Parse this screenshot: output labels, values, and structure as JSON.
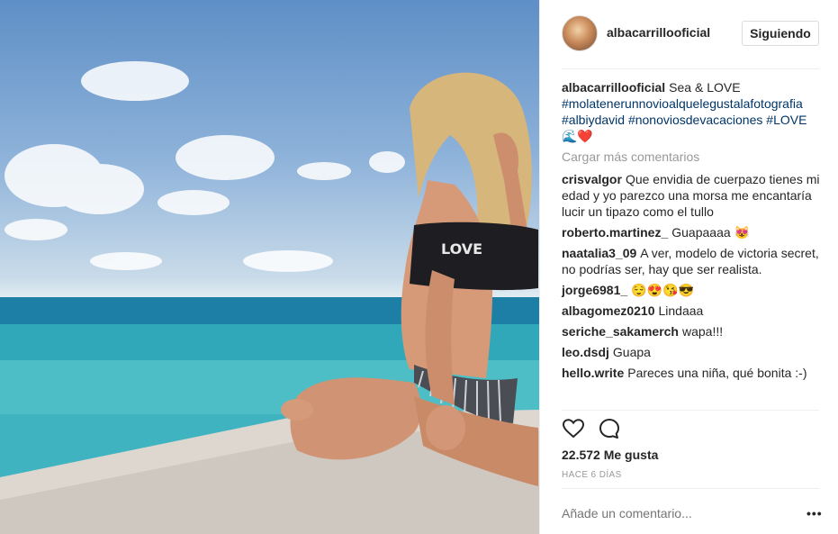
{
  "post": {
    "username": "albacarrillooficial",
    "follow_label": "Siguiendo",
    "caption_user": "albacarrillooficial",
    "caption_text": "Sea & LOVE",
    "caption_hashtags_1": "#molatenerunnovioalquelegustalafotografia #albiydavid #nonoviosdevacaciones",
    "caption_hashtags_2": "#LOVE 🌊❤️",
    "load_more": "Cargar más comentarios",
    "likes": "22.572 Me gusta",
    "time_ago": "HACE 6 DÍAS",
    "add_comment_placeholder": "Añade un comentario...",
    "more_options": "•••",
    "shirt_text": "LOVE"
  },
  "comments": [
    {
      "user": "crisvalgor",
      "text": "Que envidia de cuerpazo tienes mi edad y yo parezco una morsa me encantaría lucir un tipazo como el tullo"
    },
    {
      "user": "roberto.martinez_",
      "text": "Guapaaaa 😻"
    },
    {
      "user": "naatalia3_09",
      "text": "A ver, modelo de victoria secret, no podrías ser, hay que ser realista."
    },
    {
      "user": "jorge6981_",
      "text": "😌😍😘😎"
    },
    {
      "user": "albagomez0210",
      "text": "Lindaaa"
    },
    {
      "user": "seriche_sakamerch",
      "text": "wapa!!!"
    },
    {
      "user": "leo.dsdj",
      "text": "Guapa"
    },
    {
      "user": "hello.write",
      "text": "Pareces una niña, qué bonita :-)"
    }
  ],
  "icons": {
    "like": "heart-outline-icon",
    "comment": "speech-bubble-icon"
  },
  "colors": {
    "link": "#003569",
    "muted": "#999999",
    "text": "#262626",
    "border": "#dbdbdb"
  }
}
